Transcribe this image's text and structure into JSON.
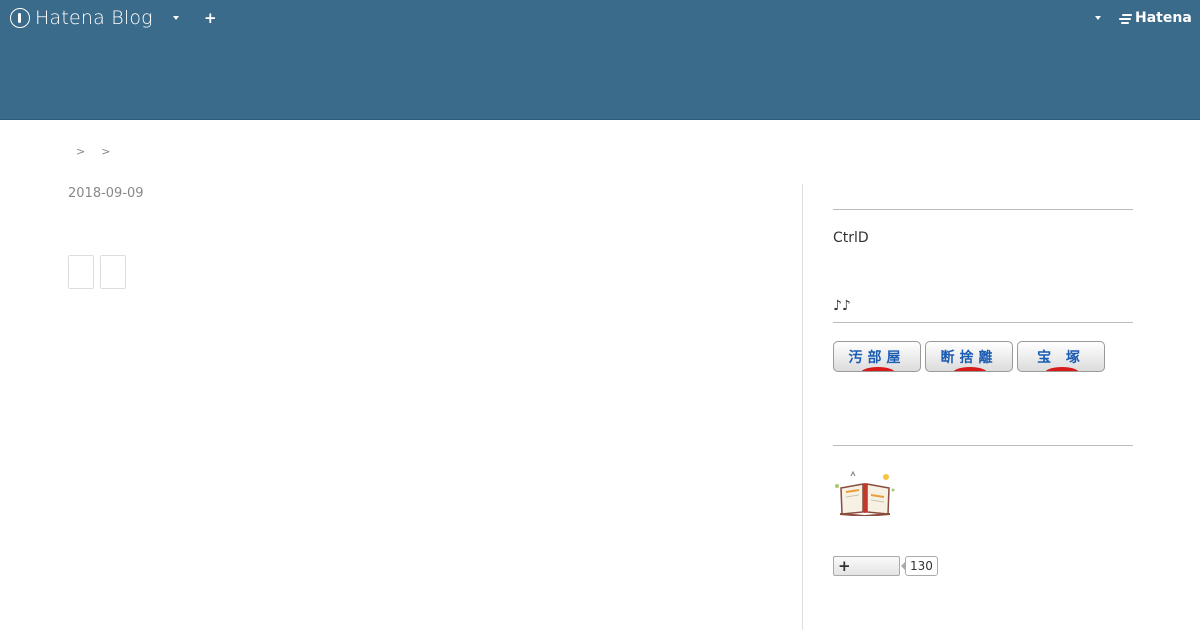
{
  "header": {
    "brand_name": "Hatena Blog",
    "hatena_label": "Hatena"
  },
  "breadcrumb": {
    "separators": [
      ">",
      ">"
    ]
  },
  "article": {
    "date": "2018-09-09"
  },
  "sidebar": {
    "profile_name": "CtrlD",
    "notes_text": "♪♪",
    "badges": [
      {
        "label": "汚部屋",
        "text_color": "#1b5db3",
        "accent": "#d91a1a"
      },
      {
        "label": "断捨離",
        "text_color": "#1b5db3",
        "accent": "#d91a1a"
      },
      {
        "label": "宝 塚",
        "text_color": "#1b5db3",
        "accent": "#d91a1a"
      }
    ],
    "reader_count": "130"
  },
  "colors": {
    "header_bg": "#3b6b8b"
  }
}
